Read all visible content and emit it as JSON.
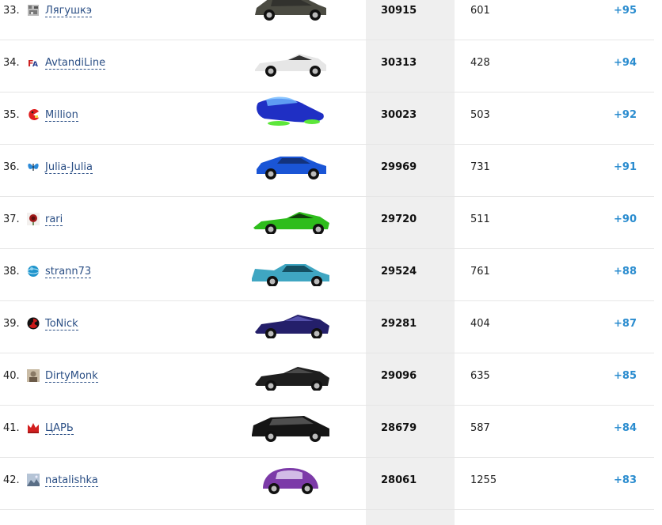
{
  "rows": [
    {
      "position": "33.",
      "name": "Лягушкэ",
      "score": "30915",
      "races": "601",
      "delta": "+95",
      "avatar_icon": "pixel-frog-icon",
      "car_icon": "sedan-gray-icon",
      "car_color": "#4b4b42",
      "avatar_color": "#777777"
    },
    {
      "position": "34.",
      "name": "AvtandiLine",
      "score": "30313",
      "races": "428",
      "delta": "+94",
      "avatar_icon": "letter-logo-icon",
      "car_icon": "supercar-white-icon",
      "car_color": "#e6e6e6",
      "avatar_color": "#cc2222"
    },
    {
      "position": "35.",
      "name": "Million",
      "score": "30023",
      "races": "503",
      "delta": "+92",
      "avatar_icon": "pacman-icon",
      "car_icon": "hover-car-blue-icon",
      "car_color": "#1f2fc4",
      "avatar_color": "#e01f1f"
    },
    {
      "position": "36.",
      "name": "Julia-Julia",
      "score": "29969",
      "races": "731",
      "delta": "+91",
      "avatar_icon": "butterfly-icon",
      "car_icon": "coupe-blue-icon",
      "car_color": "#1a55d6",
      "avatar_color": "#2b8ad8"
    },
    {
      "position": "37.",
      "name": "rari",
      "score": "29720",
      "races": "511",
      "delta": "+90",
      "avatar_icon": "rose-icon",
      "car_icon": "supercar-green-icon",
      "car_color": "#2ebd1c",
      "avatar_color": "#a01818"
    },
    {
      "position": "38.",
      "name": "strann73",
      "score": "29524",
      "races": "761",
      "delta": "+88",
      "avatar_icon": "globe-icon",
      "car_icon": "sports-car-teal-icon",
      "car_color": "#3fa6c2",
      "avatar_color": "#1f94cc"
    },
    {
      "position": "39.",
      "name": "ToNick",
      "score": "29281",
      "races": "404",
      "delta": "+87",
      "avatar_icon": "radiation-icon",
      "car_icon": "supercar-purple-icon",
      "car_color": "#241f6a",
      "avatar_color": "#cc1b1b"
    },
    {
      "position": "40.",
      "name": "DirtyMonk",
      "score": "29096",
      "races": "635",
      "delta": "+85",
      "avatar_icon": "photo-avatar-icon",
      "car_icon": "supercar-black-icon",
      "car_color": "#1e1e1e",
      "avatar_color": "#8a7a66"
    },
    {
      "position": "41.",
      "name": "ЦАРЬ",
      "score": "28679",
      "races": "587",
      "delta": "+84",
      "avatar_icon": "crown-icon",
      "car_icon": "hatchback-black-icon",
      "car_color": "#151515",
      "avatar_color": "#d21f1f"
    },
    {
      "position": "42.",
      "name": "natalishka",
      "score": "28061",
      "races": "1255",
      "delta": "+83",
      "avatar_icon": "landscape-avatar-icon",
      "car_icon": "beetle-purple-icon",
      "car_color": "#7c3aa8",
      "avatar_color": "#5a6e86"
    }
  ]
}
